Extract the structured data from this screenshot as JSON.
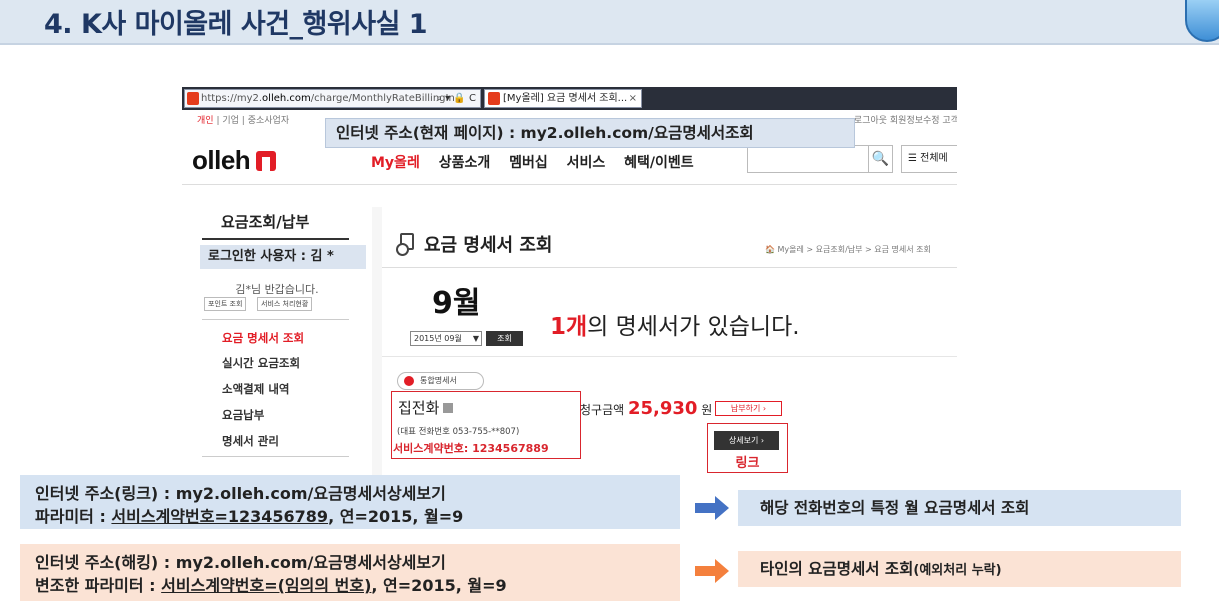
{
  "slide": {
    "title": "4. K사 마이올레 사건_행위사실 1"
  },
  "browser": {
    "url_prefix": "https://my2.",
    "url_domain": "olleh.com",
    "url_path": "/charge/MonthlyRateBillingIn",
    "url_controls": "⌕ ▾ 🔒 C",
    "tab_title": "[My올레] 요금 명세서 조회...",
    "tab_close": "×"
  },
  "site": {
    "segments": [
      "개인",
      "기업",
      "중소사업자"
    ],
    "segment_sep": "|",
    "util_links": "로그아웃   회원정보수정   고객",
    "logo_text": "olleh",
    "main_nav": [
      "My올레",
      "상품소개",
      "멤버십",
      "서비스",
      "혜택/이벤트"
    ],
    "search_icon": "🔍",
    "all_menu": "☰ 전체메",
    "sidebar": {
      "title": "요금조회/납부",
      "greeting": "김*님 반갑습니다.",
      "buttons": [
        "포인트 조회",
        "서비스 처리현황"
      ],
      "menu": [
        "요금 명세서 조회",
        "실시간 요금조회",
        "소액결제 내역",
        "요금납부",
        "명세서 관리"
      ]
    },
    "content": {
      "title": "요금 명세서 조회",
      "breadcrumb": "🏠 My올레 > 요금조회/납부 > 요금 명세서 조회",
      "month": "9월",
      "select_value": "2015년 09월",
      "select_arrow": "▼",
      "lookup_button": "조회",
      "count_num": "1개",
      "count_rest": "의 명세서가 있습니다.",
      "pill_label": "통합명세서",
      "service_name": "집전화",
      "service_tel": "(대표 전화번호 053-755-**807)",
      "service_contract": "서비스계약번호: 1234567889",
      "amount_label": "청구금액 ",
      "amount_value": "25,930",
      "amount_unit": " 원",
      "pay_button": "납부하기 ›",
      "detail_button": "상세보기 ›",
      "link_label": "링크"
    }
  },
  "annotations": {
    "url_current": "인터넷 주소(현재 페이지) : my2.olleh.com/요금명세서조회",
    "login_user": "로그인한 사용자 : 김 *"
  },
  "bottom": {
    "link_line1": "인터넷 주소(링크) : my2.olleh.com/요금명세서상세보기",
    "link_line2_prefix": "파라미터 : ",
    "link_line2_u": "서비스계약번호=123456789",
    "link_line2_suffix": ", 연=2015, 월=9",
    "link_result": "해당 전화번호의 특정 월 요금명세서 조회",
    "hack_line1": "인터넷 주소(해킹) : my2.olleh.com/요금명세서상세보기",
    "hack_line2_prefix": "변조한 파라미터 : ",
    "hack_line2_u": "서비스계약번호=(임의의 번호)",
    "hack_line2_suffix": ", 연=2015, 월=9",
    "hack_result_main": "타인의 요금명세서 조회",
    "hack_result_note": "(예외처리 누락)",
    "colors": {
      "arrow_blue": "#4472c4",
      "arrow_orange": "#f4803d",
      "accent_red": "#e21d26"
    }
  }
}
